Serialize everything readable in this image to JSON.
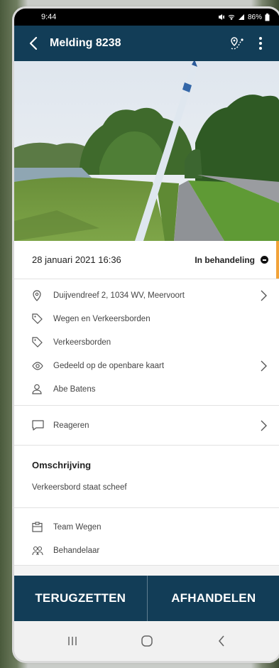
{
  "status_bar": {
    "time": "9:44",
    "battery": "86%"
  },
  "app_bar": {
    "title": "Melding 8238",
    "back_icon": "back-arrow-icon",
    "map_icon": "map-pin-route-icon",
    "menu_icon": "more-vert-icon"
  },
  "meta": {
    "date": "28 januari 2021 16:36",
    "status": "In behandeling",
    "status_color": "#f2a33a"
  },
  "details": [
    {
      "icon": "location-pin-icon",
      "text": "Duijvendreef 2, 1034 WV, Meervoort",
      "chevron": true
    },
    {
      "icon": "tag-icon",
      "text": "Wegen en Verkeersborden",
      "chevron": false
    },
    {
      "icon": "tag-icon",
      "text": "Verkeersborden",
      "chevron": false
    },
    {
      "icon": "eye-icon",
      "text": "Gedeeld op de openbare kaart",
      "chevron": true
    },
    {
      "icon": "person-icon",
      "text": "Abe Batens",
      "chevron": false
    }
  ],
  "react": {
    "label": "Reageren",
    "icon": "comment-icon"
  },
  "description": {
    "title": "Omschrijving",
    "text": "Verkeersbord staat scheef"
  },
  "team": [
    {
      "icon": "clipboard-icon",
      "text": "Team  Wegen"
    },
    {
      "icon": "handler-icon",
      "text": "Behandelaar"
    }
  ],
  "buttons": {
    "reset": "TERUGZETTEN",
    "finish": "AFHANDELEN"
  },
  "colors": {
    "primary": "#123d57",
    "accent": "#f2a33a"
  }
}
